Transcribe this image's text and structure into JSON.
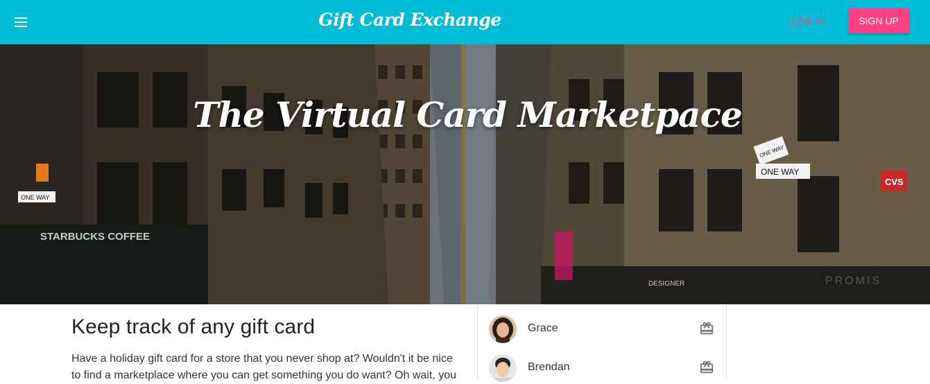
{
  "header": {
    "brand": "Gift Card Exchange",
    "login_label": "LOG IN",
    "signup_label": "SIGN UP",
    "menu_icon": "menu-icon"
  },
  "hero": {
    "title": "The Virtual Card Marketpace",
    "signs": {
      "starbucks": "STARBUCKS COFFEE",
      "one_way_1": "ONE WAY",
      "one_way_2": "ONE WAY",
      "one_way_3": "ONE WAY",
      "cvs": "CVS",
      "designer": "DESIGNER",
      "promis": "PROMIS"
    }
  },
  "feature": {
    "heading": "Keep track of any gift card",
    "body": "Have a holiday gift card for a store that you never shop at? Wouldn't it be nice to find a marketplace where you can get something you do want? Oh wait, you"
  },
  "users": [
    {
      "name": "Grace",
      "icon": "gift-card-icon"
    },
    {
      "name": "Brendan",
      "icon": "gift-card-icon"
    }
  ],
  "colors": {
    "primary": "#00bcd4",
    "accent": "#ff4081"
  }
}
